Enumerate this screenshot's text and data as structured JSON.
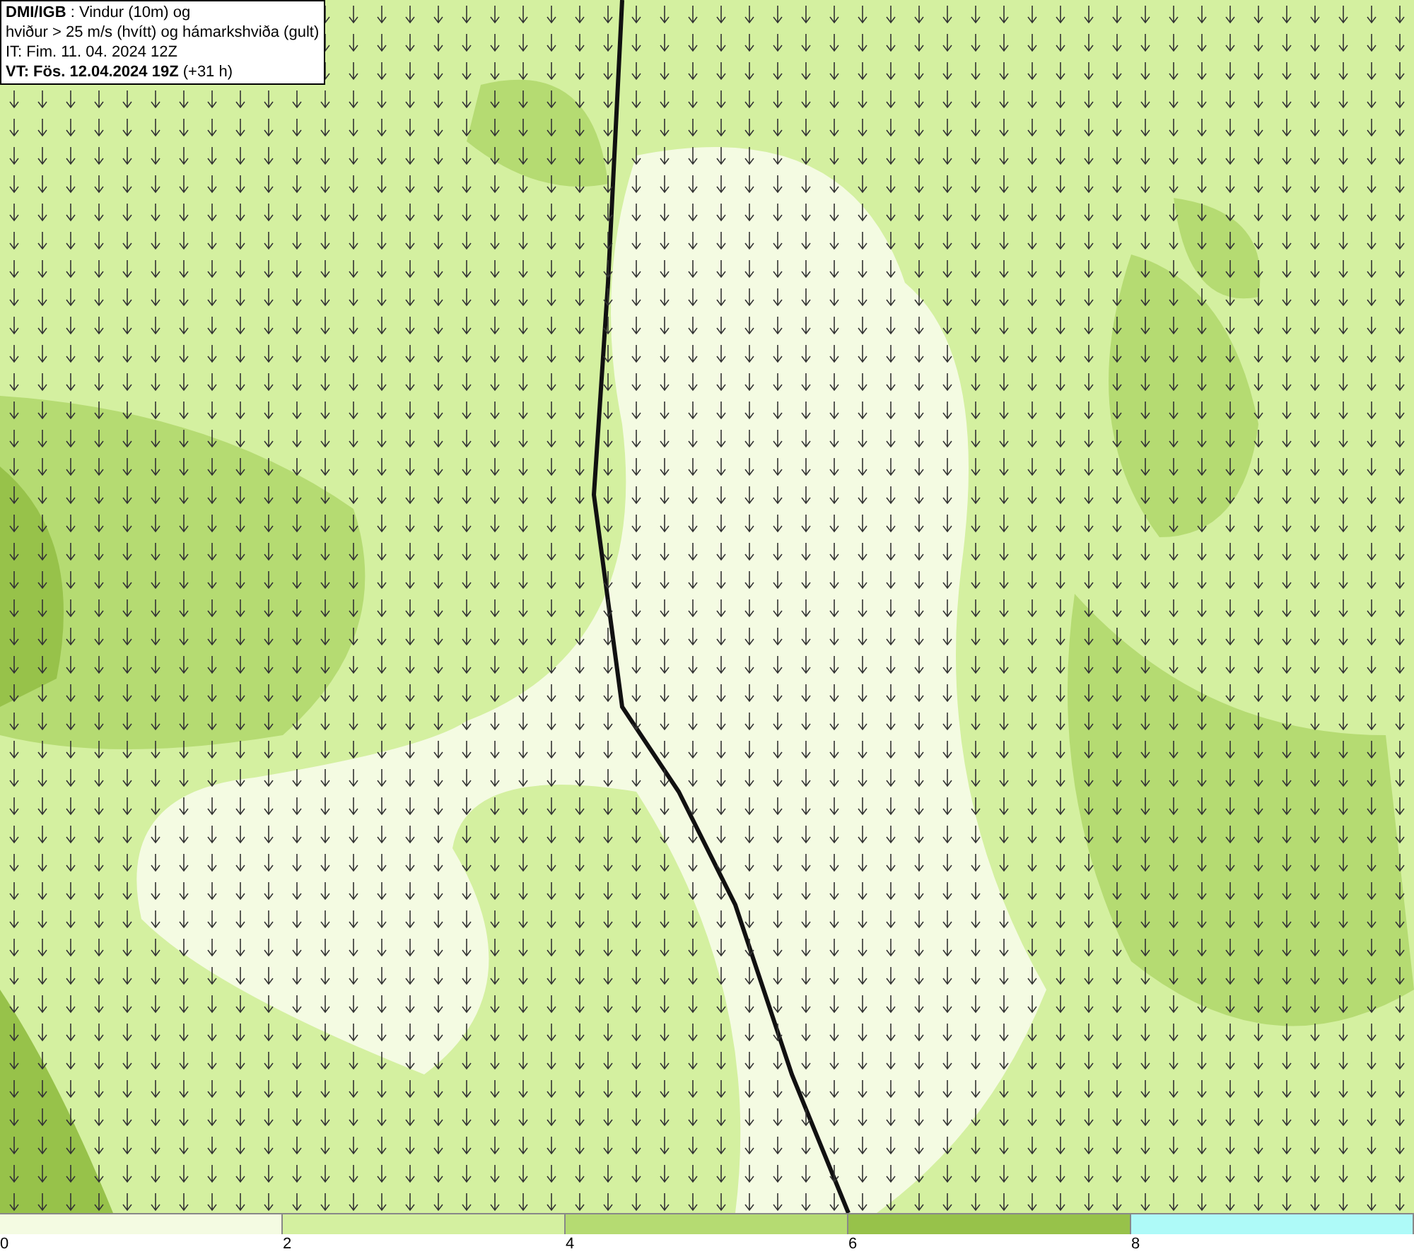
{
  "header": {
    "lines": [
      "**DMI/IGB** : Vindur (10m) og",
      "hviður > 25 m/s (hvítt) og hámarkshviða (gult)",
      "IT: Fim. 11. 04. 2024 12Z",
      "**VT: Fös. 12.04.2024 19Z** (+31 h)"
    ]
  },
  "legend": {
    "segments": [
      {
        "label": "0",
        "color": "#f4fbe2"
      },
      {
        "label": "2",
        "color": "#d4f0a0"
      },
      {
        "label": "4",
        "color": "#b5db72"
      },
      {
        "label": "6",
        "color": "#97c24a"
      },
      {
        "label": "8",
        "color": "#aefaf8"
      }
    ]
  }
}
